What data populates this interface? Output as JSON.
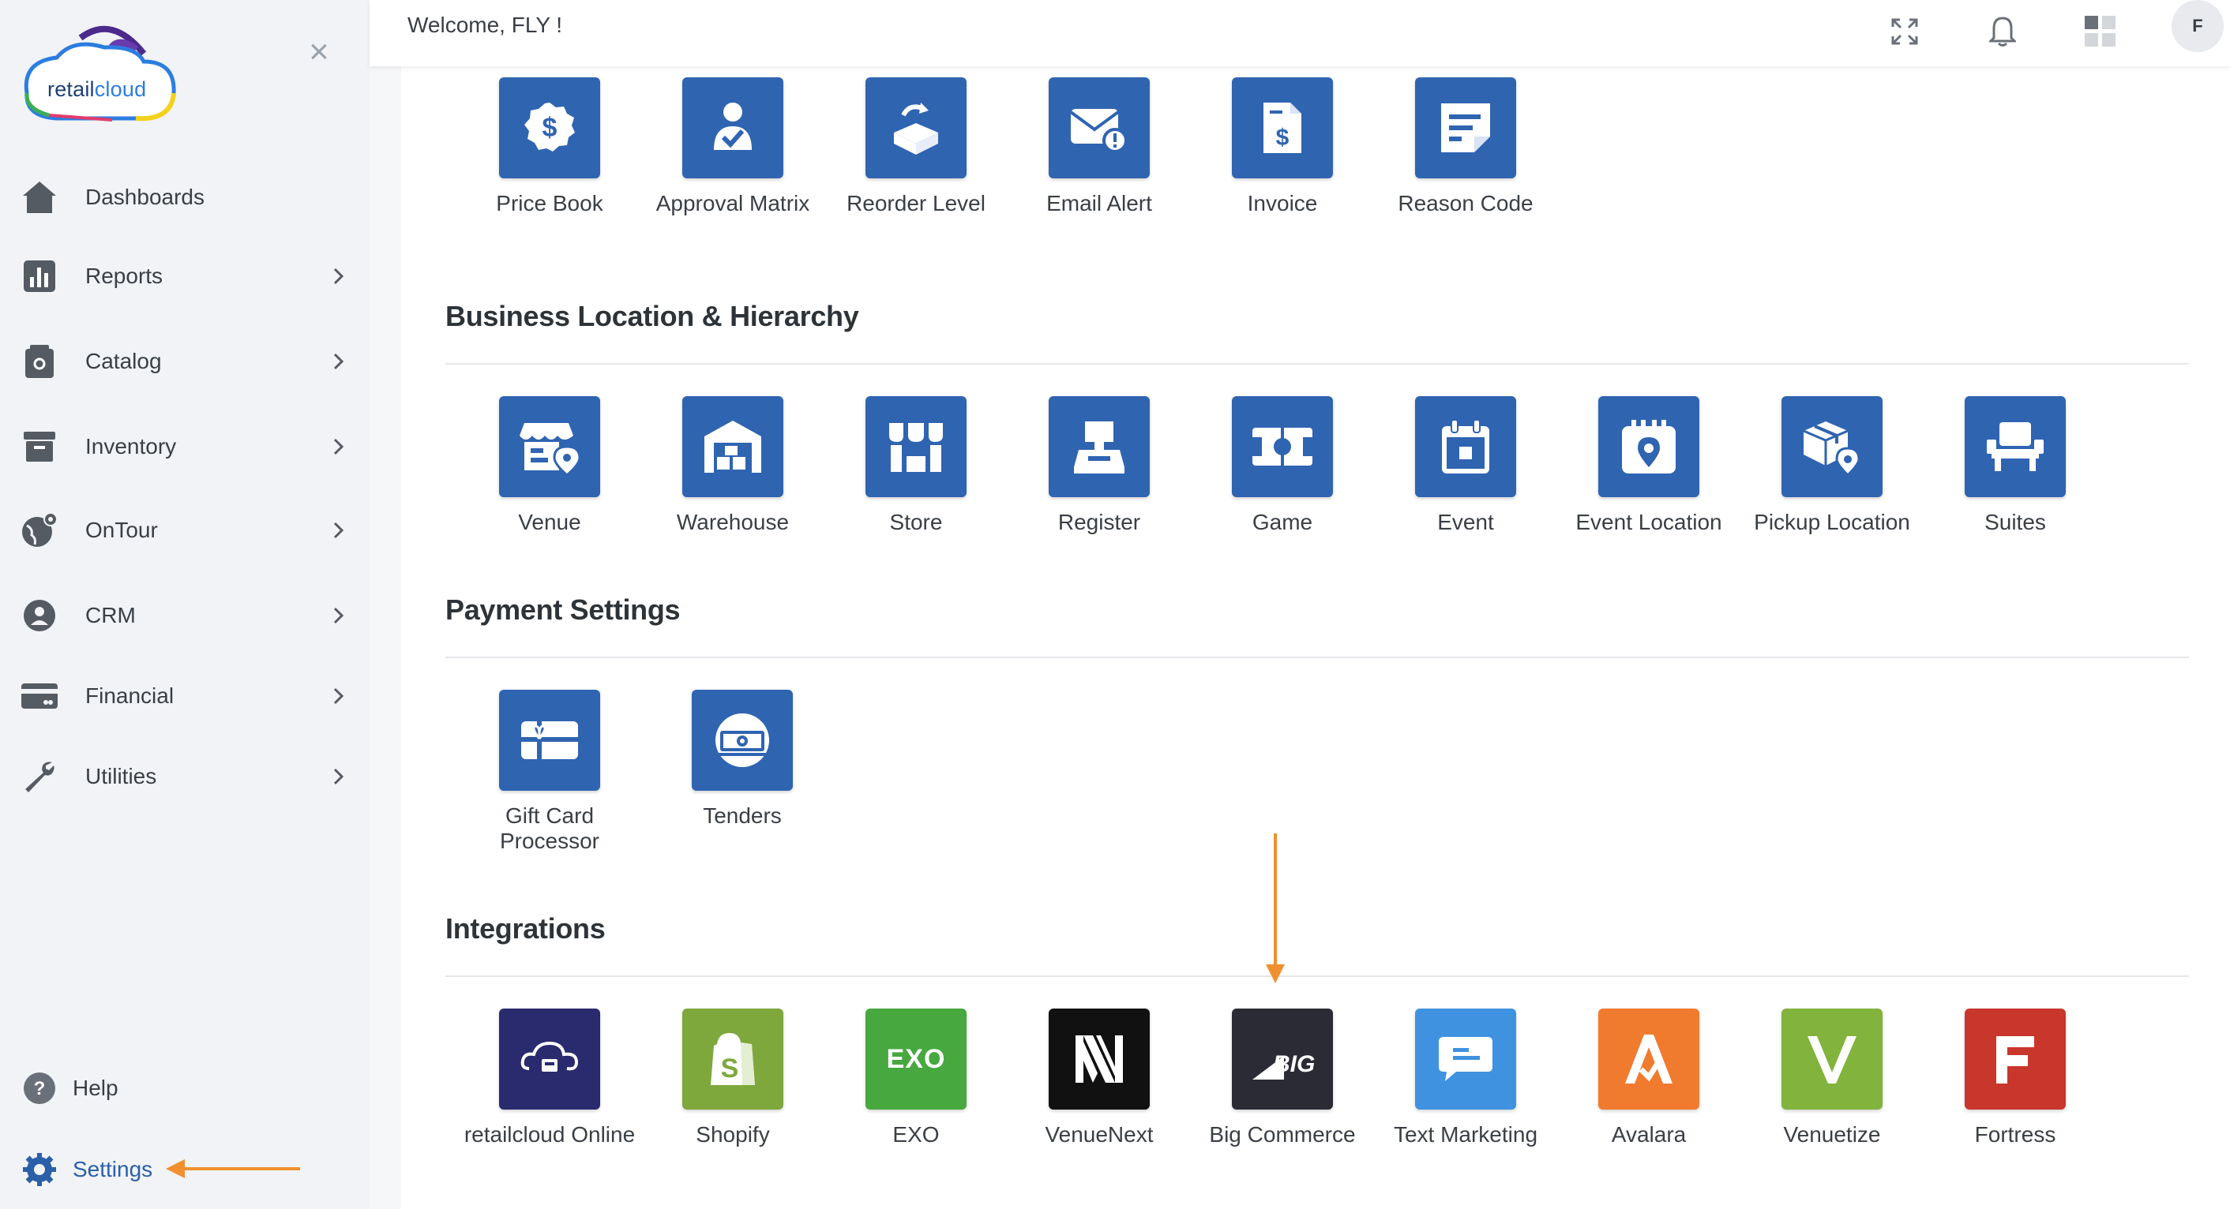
{
  "app": {
    "brand": "retailcloud",
    "brand_part1": "retail",
    "brand_part2": "cloud"
  },
  "header": {
    "welcome": "Welcome, FLY !",
    "avatar_initial": "F",
    "icons": [
      "fullscreen-icon",
      "bell-icon",
      "grid-apps-icon"
    ]
  },
  "sidebar": {
    "items": [
      {
        "label": "Dashboards",
        "icon": "home-icon"
      },
      {
        "label": "Reports",
        "icon": "bar-chart-icon"
      },
      {
        "label": "Catalog",
        "icon": "catalog-icon"
      },
      {
        "label": "Inventory",
        "icon": "archive-icon"
      },
      {
        "label": "OnTour",
        "icon": "globe-pin-icon"
      },
      {
        "label": "CRM",
        "icon": "crm-gear-icon"
      },
      {
        "label": "Financial",
        "icon": "credit-card-icon"
      },
      {
        "label": "Utilities",
        "icon": "wrench-icon"
      }
    ],
    "help": "Help",
    "settings": "Settings"
  },
  "top_row": [
    {
      "label": "Price Book",
      "icon": "dollar-badge-icon"
    },
    {
      "label": "Approval Matrix",
      "icon": "user-check-icon"
    },
    {
      "label": "Reorder Level",
      "icon": "box-refresh-icon"
    },
    {
      "label": "Email Alert",
      "icon": "email-alert-icon"
    },
    {
      "label": "Invoice",
      "icon": "invoice-icon"
    },
    {
      "label": "Reason Code",
      "icon": "note-icon"
    }
  ],
  "sections": {
    "business": "Business Location & Hierarchy",
    "payment": "Payment Settings",
    "integrations": "Integrations"
  },
  "business_items": [
    {
      "label": "Venue",
      "icon": "venue-icon"
    },
    {
      "label": "Warehouse",
      "icon": "warehouse-icon"
    },
    {
      "label": "Store",
      "icon": "store-icon"
    },
    {
      "label": "Register",
      "icon": "register-icon"
    },
    {
      "label": "Game",
      "icon": "game-icon"
    },
    {
      "label": "Event",
      "icon": "calendar-icon"
    },
    {
      "label": "Event Location",
      "icon": "calendar-pin-icon"
    },
    {
      "label": "Pickup Location",
      "icon": "package-pin-icon"
    },
    {
      "label": "Suites",
      "icon": "chair-icon"
    }
  ],
  "payment_items": [
    {
      "label": "Gift Card Processor",
      "icon": "gift-card-icon"
    },
    {
      "label": "Tenders",
      "icon": "cash-icon"
    }
  ],
  "integration_items": [
    {
      "label": "retailcloud Online",
      "icon": "cloud-register-logo",
      "color": "#2a2a6e"
    },
    {
      "label": "Shopify",
      "icon": "shopify-logo",
      "color": "#7ea73c"
    },
    {
      "label": "EXO",
      "icon": "exo-logo",
      "color": "#46a83f",
      "logo_text": "EXO"
    },
    {
      "label": "VenueNext",
      "icon": "venuenext-logo",
      "color": "#111111"
    },
    {
      "label": "Big Commerce",
      "icon": "bigcommerce-logo",
      "color": "#2b2b35",
      "logo_text": "BIG"
    },
    {
      "label": "Text Marketing",
      "icon": "chat-bubble-icon",
      "color": "#3f92df"
    },
    {
      "label": "Avalara",
      "icon": "avalara-logo",
      "color": "#f07b2e"
    },
    {
      "label": "Venuetize",
      "icon": "venuetize-logo",
      "color": "#82b33c"
    },
    {
      "label": "Fortress",
      "icon": "fortress-logo",
      "color": "#c9362c"
    }
  ],
  "colors": {
    "tile_blue": "#2f64b1",
    "annotation_orange": "#f0902e",
    "sidebar_bg": "#f1f3f6"
  }
}
